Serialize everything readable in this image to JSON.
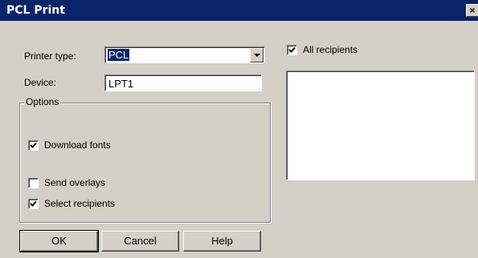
{
  "window": {
    "title": "PCL Print",
    "close_symbol": "×"
  },
  "printer_type": {
    "label": "Printer type:",
    "value": "PCL"
  },
  "device": {
    "label": "Device:",
    "value": "LPT1"
  },
  "options": {
    "legend": "Options",
    "download_fonts": {
      "label": "Download fonts",
      "checked": true
    },
    "send_overlays": {
      "label": "Send overlays",
      "checked": false
    },
    "select_recipients": {
      "label": "Select recipients",
      "checked": true
    }
  },
  "recipients": {
    "all_label": "All recipients",
    "all_checked": true,
    "items": []
  },
  "buttons": {
    "ok": "OK",
    "cancel": "Cancel",
    "help": "Help"
  },
  "colors": {
    "title_bar": "#0a246a",
    "dialog_bg": "#d4d0c8",
    "selection": "#0a246a"
  },
  "icons": {
    "dropdown": "chevron-down-icon",
    "check": "check-icon",
    "close": "close-icon"
  }
}
